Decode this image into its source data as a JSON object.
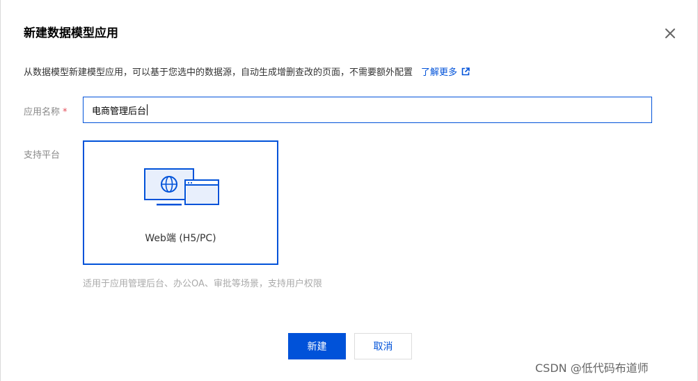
{
  "dialog": {
    "title": "新建数据模型应用",
    "close_icon": "close-icon",
    "description": "从数据模型新建模型应用，可以基于您选中的数据源，自动生成增删查改的页面，不需要额外配置",
    "learn_more": "了解更多",
    "learn_more_icon": "external-link-icon"
  },
  "form": {
    "name_label": "应用名称",
    "required_mark": "*",
    "name_value": "电商管理后台",
    "platform_label": "支持平台",
    "platform_option": {
      "label": "Web端 (H5/PC)",
      "icon": "web-platform-icon",
      "selected": true
    },
    "platform_hint": "适用于应用管理后台、办公OA、审批等场景，支持用户权限"
  },
  "footer": {
    "confirm_label": "新建",
    "cancel_label": "取消"
  },
  "watermark": "CSDN @低代码布道师",
  "colors": {
    "primary": "#0052d9",
    "required": "#e34d59",
    "illustration_fill": "#e8effc"
  }
}
